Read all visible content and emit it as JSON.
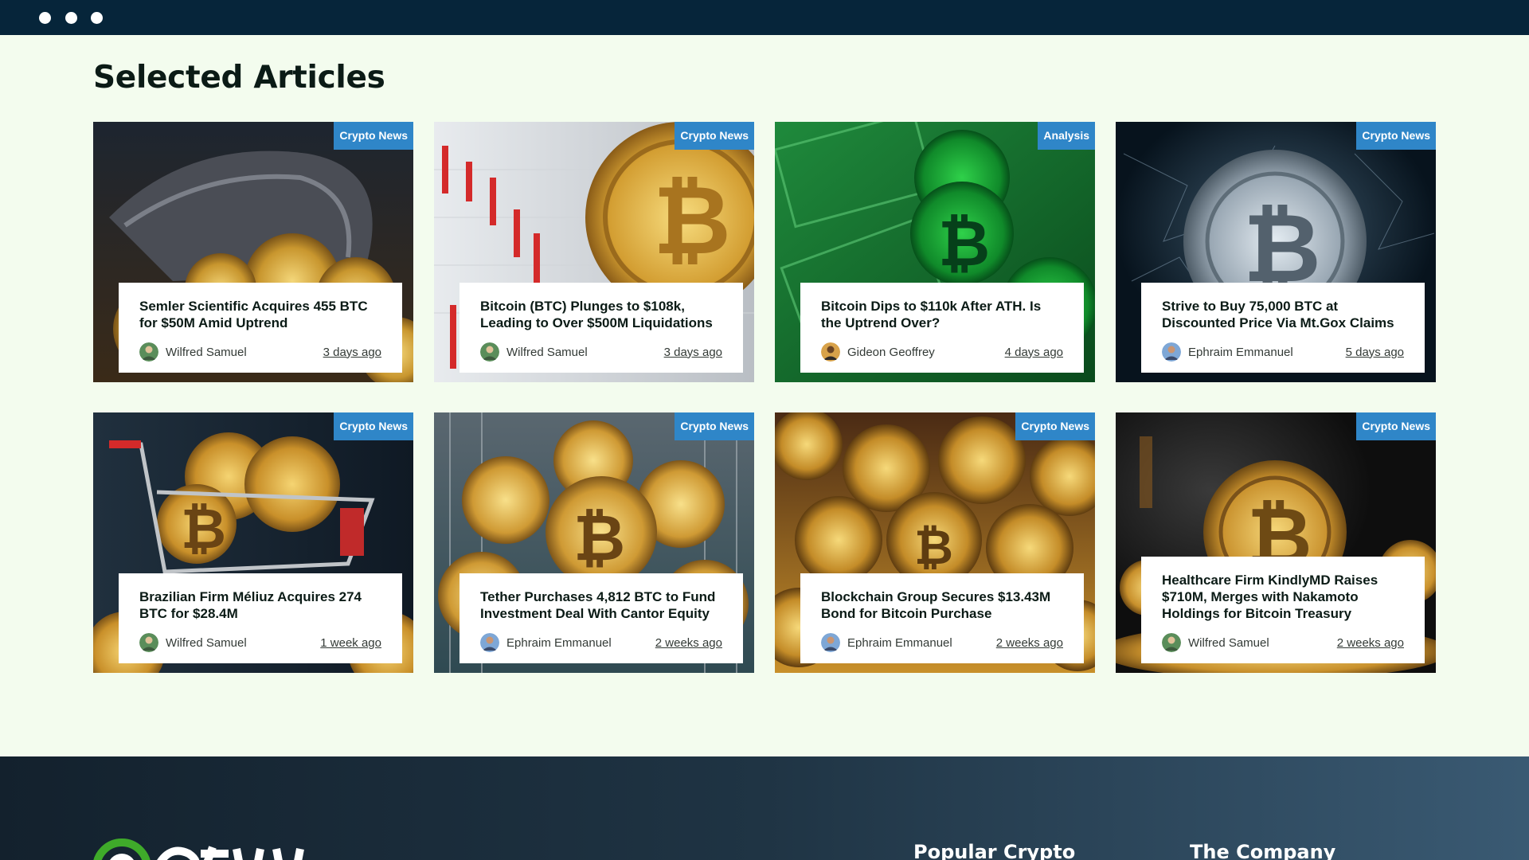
{
  "window": {
    "controls": [
      "close",
      "minimize",
      "maximize"
    ]
  },
  "section": {
    "title": "Selected Articles"
  },
  "colors": {
    "accent": "#2f86c8",
    "background": "#f3fcee",
    "topbar": "#06253a"
  },
  "articles": [
    {
      "tag": "Crypto News",
      "title": "Semler Scientific Acquires 455 BTC for $50M Amid Uptrend",
      "author": "Wilfred Samuel",
      "time": "3 days ago",
      "image": "coins-spilling-from-bag"
    },
    {
      "tag": "Crypto News",
      "title": "Bitcoin (BTC) Plunges to $108k, Leading to Over $500M Liquidations",
      "author": "Wilfred Samuel",
      "time": "3 days ago",
      "image": "bitcoin-coin-on-chart"
    },
    {
      "tag": "Analysis",
      "title": "Bitcoin Dips to $110k After ATH. Is the Uptrend Over?",
      "author": "Gideon Geoffrey",
      "time": "4 days ago",
      "image": "bitcoin-on-green-banknotes"
    },
    {
      "tag": "Crypto News",
      "title": "Strive to Buy 75,000 BTC at Discounted Price Via Mt.Gox Claims",
      "author": "Ephraim Emmanuel",
      "time": "5 days ago",
      "image": "silver-bitcoin-network"
    },
    {
      "tag": "Crypto News",
      "title": "Brazilian Firm Méliuz Acquires 274 BTC for $28.4M",
      "author": "Wilfred Samuel",
      "time": "1 week ago",
      "image": "shopping-cart-with-bitcoins"
    },
    {
      "tag": "Crypto News",
      "title": "Tether Purchases 4,812 BTC to Fund Investment Deal With Cantor Equity",
      "author": "Ephraim Emmanuel",
      "time": "2 weeks ago",
      "image": "cart-full-of-bitcoins"
    },
    {
      "tag": "Crypto News",
      "title": "Blockchain Group Secures $13.43M Bond for Bitcoin Purchase",
      "author": "Ephraim Emmanuel",
      "time": "2 weeks ago",
      "image": "pile-of-bitcoins"
    },
    {
      "tag": "Crypto News",
      "title": "Healthcare Firm KindlyMD Raises $710M, Merges with Nakamoto Holdings for Bitcoin Treasury",
      "author": "Wilfred Samuel",
      "time": "2 weeks ago",
      "image": "bitcoin-coin-dark"
    }
  ],
  "footer": {
    "logo": "logo-mark",
    "headings": [
      "Popular Crypto",
      "The Company"
    ]
  }
}
